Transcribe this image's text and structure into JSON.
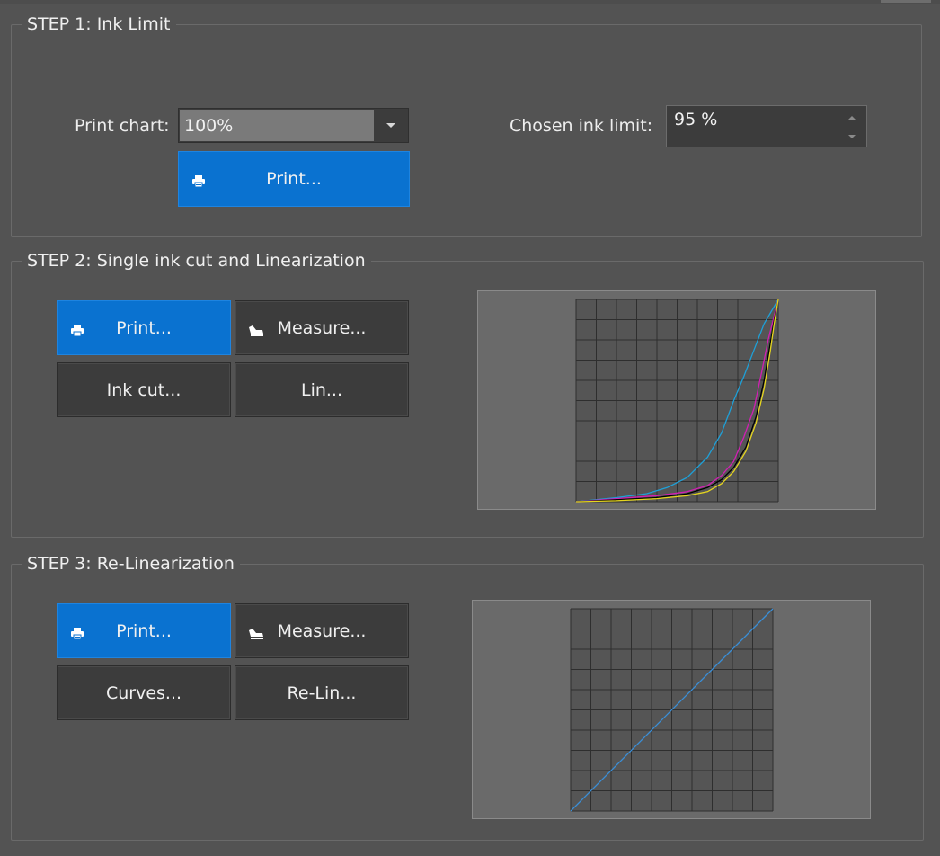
{
  "step1": {
    "title": "STEP 1: Ink Limit",
    "print_chart_label": "Print chart:",
    "print_chart_value": "100%",
    "print_button": "Print...",
    "chosen_ink_limit_label": "Chosen ink limit:",
    "chosen_ink_limit_value": "95 %"
  },
  "step2": {
    "title": "STEP 2: Single ink cut and Linearization",
    "print_button": "Print...",
    "measure_button": "Measure...",
    "ink_cut_button": "Ink cut...",
    "lin_button": "Lin...",
    "chart_data": {
      "type": "line",
      "x_range": [
        0,
        100
      ],
      "y_range": [
        0,
        100
      ],
      "grid": true,
      "gridlines": 10,
      "series": [
        {
          "color": "#1ea0d8",
          "points": [
            [
              0,
              0
            ],
            [
              20,
              2
            ],
            [
              35,
              4
            ],
            [
              45,
              7
            ],
            [
              55,
              12
            ],
            [
              65,
              22
            ],
            [
              72,
              34
            ],
            [
              78,
              50
            ],
            [
              83,
              62
            ],
            [
              88,
              75
            ],
            [
              93,
              88
            ],
            [
              100,
              100
            ]
          ]
        },
        {
          "color": "#d21fb4",
          "points": [
            [
              0,
              0
            ],
            [
              20,
              1.5
            ],
            [
              40,
              3
            ],
            [
              55,
              5
            ],
            [
              65,
              8
            ],
            [
              72,
              13
            ],
            [
              78,
              20
            ],
            [
              83,
              32
            ],
            [
              88,
              46
            ],
            [
              92,
              65
            ],
            [
              95,
              80
            ],
            [
              98,
              92
            ],
            [
              100,
              100
            ]
          ]
        },
        {
          "color": "#000000",
          "points": [
            [
              0,
              0
            ],
            [
              20,
              1
            ],
            [
              40,
              2
            ],
            [
              55,
              4
            ],
            [
              65,
              7
            ],
            [
              72,
              11
            ],
            [
              78,
              17
            ],
            [
              84,
              27
            ],
            [
              89,
              42
            ],
            [
              93,
              60
            ],
            [
              96,
              78
            ],
            [
              98,
              90
            ],
            [
              100,
              100
            ]
          ]
        },
        {
          "color": "#e6d61e",
          "points": [
            [
              0,
              0
            ],
            [
              20,
              0.5
            ],
            [
              40,
              1.5
            ],
            [
              55,
              3
            ],
            [
              65,
              5
            ],
            [
              72,
              9
            ],
            [
              78,
              15
            ],
            [
              84,
              25
            ],
            [
              89,
              39
            ],
            [
              93,
              56
            ],
            [
              96,
              74
            ],
            [
              98,
              88
            ],
            [
              100,
              100
            ]
          ]
        }
      ]
    }
  },
  "step3": {
    "title": "STEP 3: Re-Linearization",
    "print_button": "Print...",
    "measure_button": "Measure...",
    "curves_button": "Curves...",
    "relin_button": "Re-Lin...",
    "chart_data": {
      "type": "line",
      "x_range": [
        0,
        100
      ],
      "y_range": [
        0,
        100
      ],
      "grid": true,
      "gridlines": 10,
      "series": [
        {
          "color": "#3a8fd8",
          "points": [
            [
              0,
              0
            ],
            [
              100,
              100
            ]
          ]
        }
      ]
    }
  },
  "icons": {
    "printer": "printer-icon",
    "measure": "spectrophotometer-icon",
    "dropdown": "chevron-down-icon",
    "spin_up": "spin-up-icon",
    "spin_down": "spin-down-icon"
  }
}
